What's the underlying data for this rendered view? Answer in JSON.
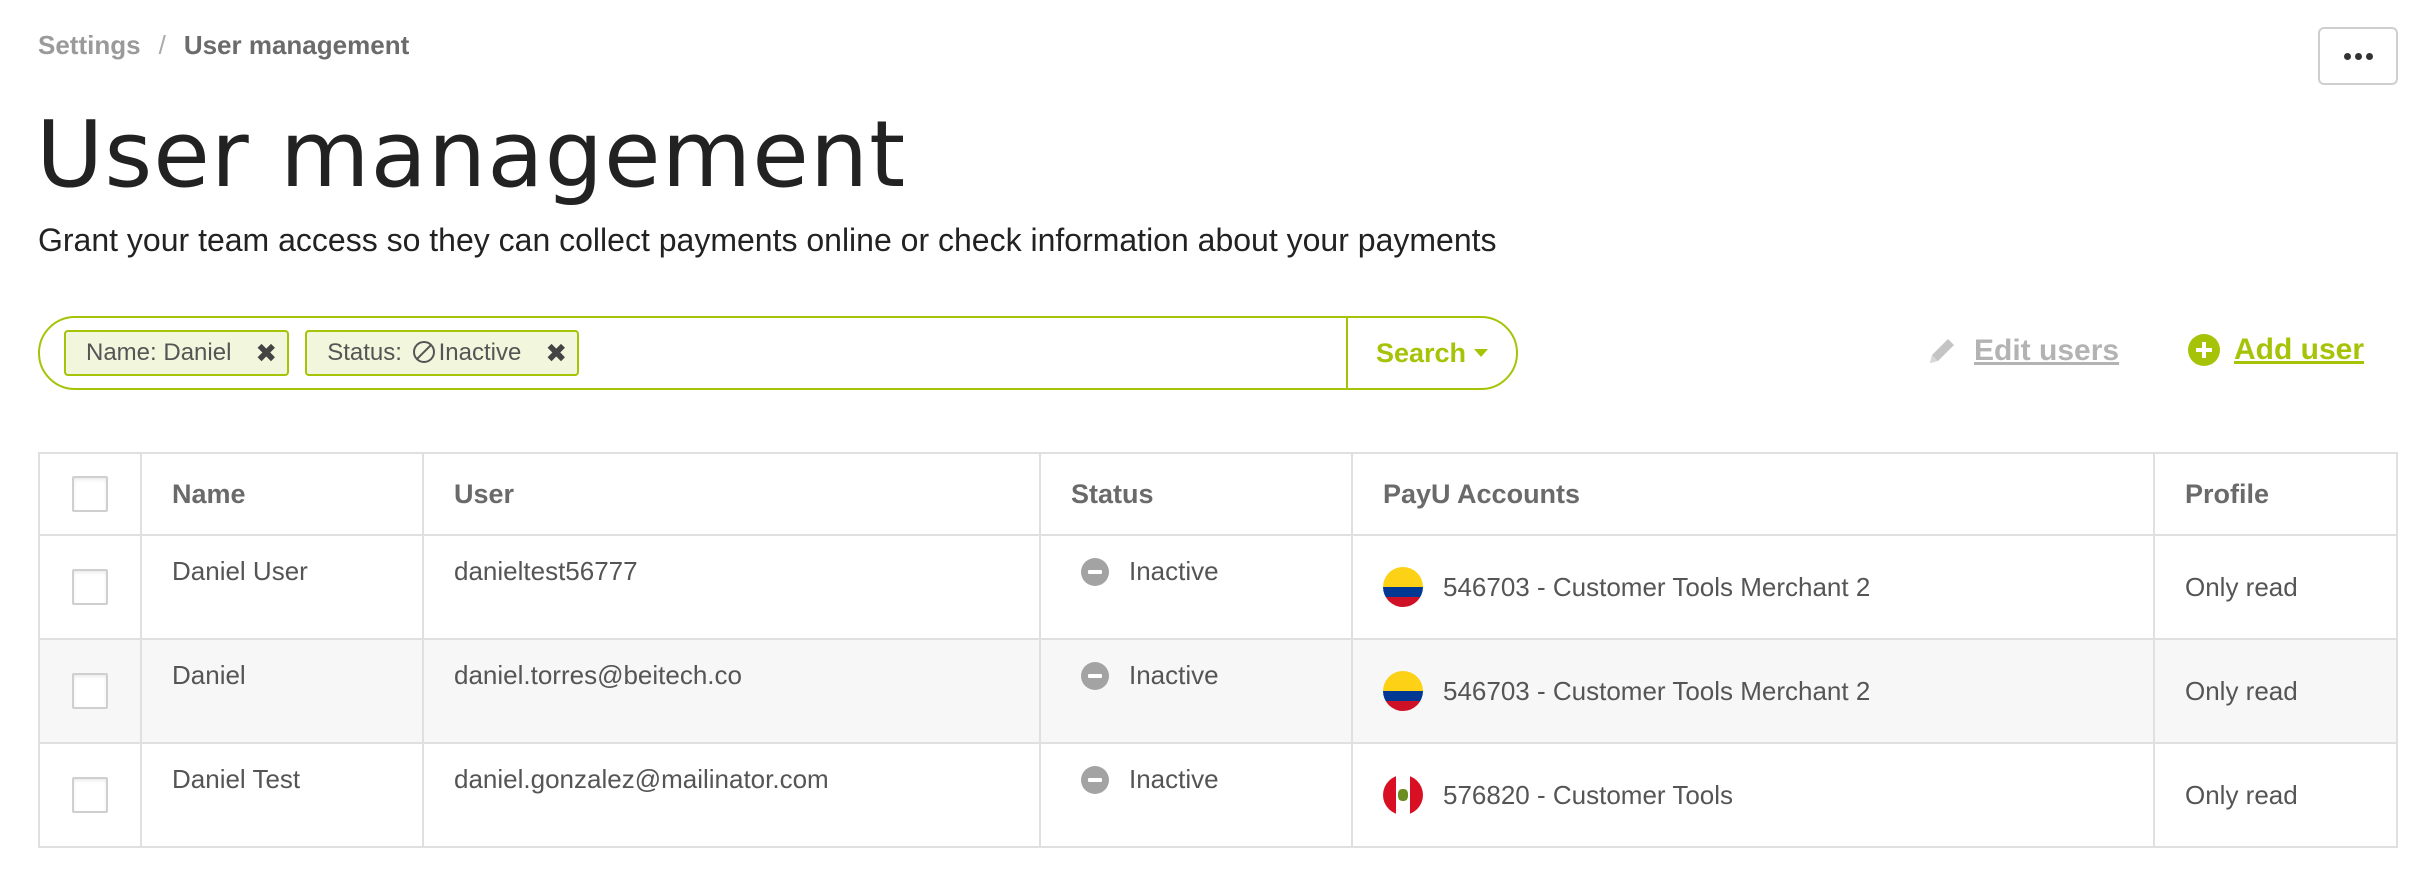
{
  "breadcrumb": {
    "parent": "Settings",
    "separator": "/",
    "current": "User management"
  },
  "page": {
    "title": "User management",
    "subtitle": "Grant your team access so they can collect payments online or check information about your payments"
  },
  "filters": {
    "chips": [
      {
        "label": "Name: Daniel"
      },
      {
        "label_prefix": "Status:",
        "label_suffix": "Inactive"
      }
    ],
    "search_label": "Search"
  },
  "actions": {
    "edit_users": "Edit users",
    "add_user": "Add user"
  },
  "table": {
    "headers": {
      "name": "Name",
      "user": "User",
      "status": "Status",
      "accounts": "PayU Accounts",
      "profile": "Profile"
    },
    "rows": [
      {
        "name": "Daniel User",
        "user": "danieltest56777",
        "status": "Inactive",
        "account": "546703 - Customer Tools Merchant 2",
        "flag": "colombia-flag",
        "profile": "Only read"
      },
      {
        "name": "Daniel",
        "user": "daniel.torres@beitech.co",
        "status": "Inactive",
        "account": "546703 - Customer Tools Merchant 2",
        "flag": "colombia-flag",
        "profile": "Only read"
      },
      {
        "name": "Daniel Test",
        "user": "daniel.gonzalez@mailinator.com",
        "status": "Inactive",
        "account": "576820 - Customer Tools",
        "flag": "peru-flag",
        "profile": "Only read"
      }
    ]
  },
  "colors": {
    "accent": "#a6c307",
    "muted": "#b3b3b3",
    "border": "#e0e0e0"
  }
}
